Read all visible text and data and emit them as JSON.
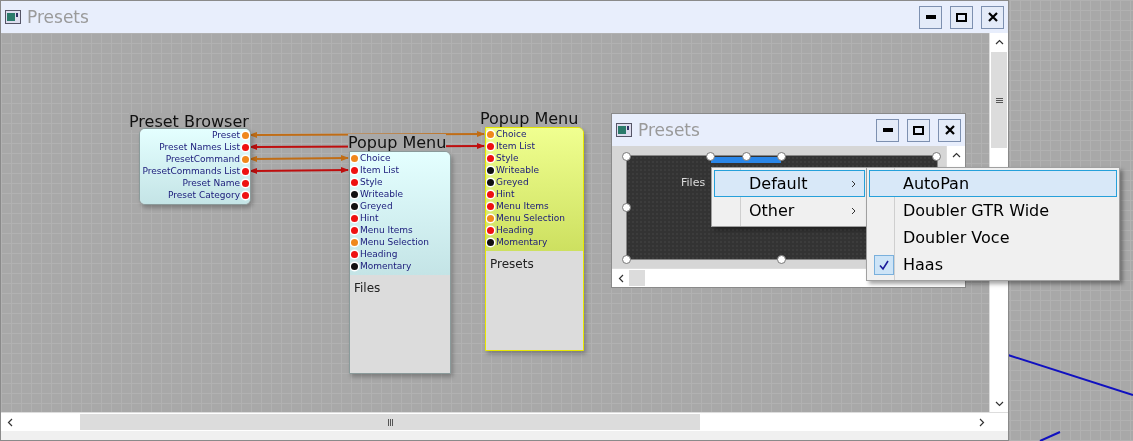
{
  "window": {
    "title": "Presets"
  },
  "canvas": {
    "nodes": [
      {
        "title": "Preset Browser",
        "kind": "outputs",
        "selected": false,
        "pins": [
          {
            "label": "Preset",
            "color": "#f0881c"
          },
          {
            "label": "Preset Names List",
            "color": "#ee1111"
          },
          {
            "label": "PresetCommand",
            "color": "#f0881c"
          },
          {
            "label": "PresetCommands List",
            "color": "#ee1111"
          },
          {
            "label": "Preset Name",
            "color": "#ee1111"
          },
          {
            "label": "Preset Category",
            "color": "#ee1111"
          }
        ]
      },
      {
        "title": "Popup Menu",
        "kind": "inputs",
        "selected": false,
        "body": "Files",
        "pins": [
          {
            "label": "Choice",
            "color": "#f0881c"
          },
          {
            "label": "Item List",
            "color": "#ee1111"
          },
          {
            "label": "Style",
            "color": "#ee1111"
          },
          {
            "label": "Writeable",
            "color": "#111111"
          },
          {
            "label": "Greyed",
            "color": "#111111"
          },
          {
            "label": "Hint",
            "color": "#ee1111"
          },
          {
            "label": "Menu Items",
            "color": "#ee1111"
          },
          {
            "label": "Menu Selection",
            "color": "#f0881c"
          },
          {
            "label": "Heading",
            "color": "#ee1111"
          },
          {
            "label": "Momentary",
            "color": "#111111"
          }
        ]
      },
      {
        "title": "Popup Menu",
        "kind": "inputs",
        "selected": true,
        "body": "Presets",
        "pins": [
          {
            "label": "Choice",
            "color": "#f0881c"
          },
          {
            "label": "Item List",
            "color": "#ee1111"
          },
          {
            "label": "Style",
            "color": "#ee1111"
          },
          {
            "label": "Writeable",
            "color": "#111111"
          },
          {
            "label": "Greyed",
            "color": "#111111"
          },
          {
            "label": "Hint",
            "color": "#ee1111"
          },
          {
            "label": "Menu Items",
            "color": "#ee1111"
          },
          {
            "label": "Menu Selection",
            "color": "#f0881c"
          },
          {
            "label": "Heading",
            "color": "#ee1111"
          },
          {
            "label": "Momentary",
            "color": "#111111"
          }
        ]
      }
    ]
  },
  "panel_window": {
    "title": "Presets",
    "panel_label": "Files",
    "menu": [
      {
        "label": "Default",
        "selected": true
      },
      {
        "label": "Other",
        "selected": false
      }
    ],
    "submenu": [
      {
        "label": "AutoPan",
        "selected": true,
        "checked": false
      },
      {
        "label": "Doubler GTR Wide",
        "selected": false,
        "checked": false
      },
      {
        "label": "Doubler Voce",
        "selected": false,
        "checked": false
      },
      {
        "label": "Haas",
        "selected": false,
        "checked": true
      }
    ]
  }
}
